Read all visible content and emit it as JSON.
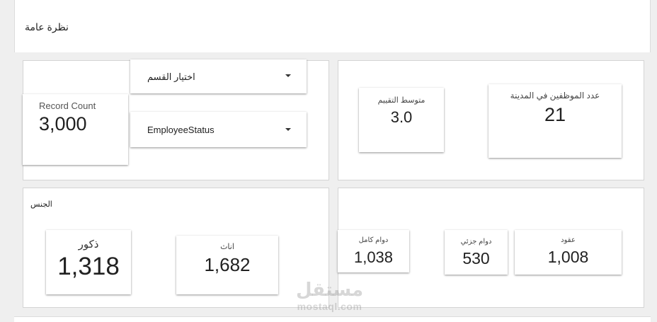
{
  "header": {
    "title": "نظرة عامة"
  },
  "filters": {
    "department_select": "اختيار القسم",
    "employee_status_select": "EmployeeStatus"
  },
  "kpis": {
    "record_count": {
      "label": "Record Count",
      "value": "3,000"
    },
    "avg_rating": {
      "label": "متوسط التقييم",
      "value": "3.0"
    },
    "city_employees": {
      "label": "عدد الموظفين في المدينة",
      "value": "21"
    }
  },
  "gender": {
    "title": "الجنس",
    "male": {
      "label": "ذكور",
      "value": "1,318"
    },
    "female": {
      "label": "اناث",
      "value": "1,682"
    }
  },
  "employment": {
    "full_time": {
      "label": "دوام كامل",
      "value": "1,038"
    },
    "part_time": {
      "label": "دوام جزئي",
      "value": "530"
    },
    "contract": {
      "label": "عقود",
      "value": "1,008"
    }
  },
  "watermark": {
    "brand": "مستقل",
    "domain": "mostaql.com"
  }
}
